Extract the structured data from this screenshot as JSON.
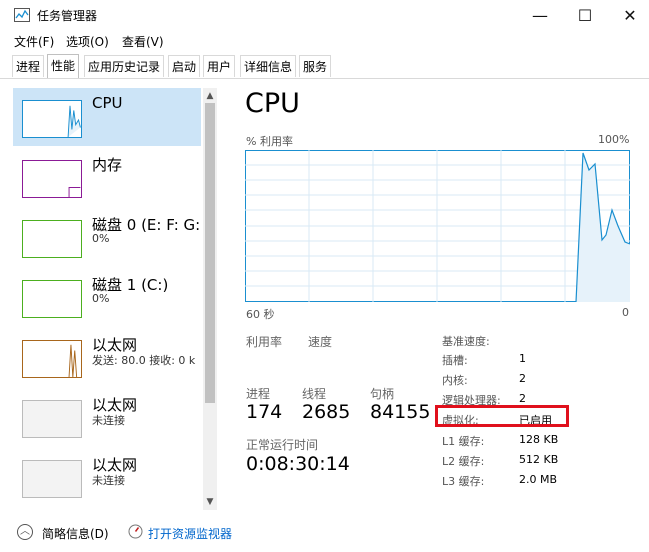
{
  "window": {
    "title": "任务管理器",
    "minimize": "—",
    "maximize": "☐",
    "close": "✕"
  },
  "menu": [
    "文件(F)",
    "选项(O)",
    "查看(V)"
  ],
  "tabs": [
    "进程",
    "性能",
    "应用历史记录",
    "启动",
    "用户",
    "详细信息",
    "服务"
  ],
  "active_tab": "性能",
  "sidebar": {
    "items": [
      {
        "title": "CPU",
        "sub": "",
        "color": "#1a8fd0"
      },
      {
        "title": "内存",
        "sub": "",
        "color": "#8b1a96"
      },
      {
        "title": "磁盘 0 (E: F: G:",
        "sub": "0%",
        "color": "#4caf1f"
      },
      {
        "title": "磁盘 1 (C:)",
        "sub": "0%",
        "color": "#4caf1f"
      },
      {
        "title": "以太网",
        "sub": "发送: 80.0  接收: 0 k",
        "color": "#a8661c"
      },
      {
        "title": "以太网",
        "sub": "未连接",
        "color": "#bbbbbb"
      },
      {
        "title": "以太网",
        "sub": "未连接",
        "color": "#bbbbbb"
      }
    ]
  },
  "cpu": {
    "title": "CPU",
    "graph_label": "% 利用率",
    "graph_max": "100%",
    "graph_time": "60 秒",
    "graph_zero": "0",
    "utilization_label": "利用率",
    "speed_label": "速度",
    "processes_label": "进程",
    "processes": "174",
    "threads_label": "线程",
    "threads": "2685",
    "handles_label": "句柄",
    "handles": "84155",
    "uptime_label": "正常运行时间",
    "uptime": "0:08:30:14",
    "specs": [
      {
        "label": "基准速度:",
        "value": ""
      },
      {
        "label": "插槽:",
        "value": "1"
      },
      {
        "label": "内核:",
        "value": "2"
      },
      {
        "label": "逻辑处理器:",
        "value": "2"
      },
      {
        "label": "虚拟化:",
        "value": "已启用"
      },
      {
        "label": "L1 缓存:",
        "value": "128 KB"
      },
      {
        "label": "L2 缓存:",
        "value": "512 KB"
      },
      {
        "label": "L3 缓存:",
        "value": "2.0 MB"
      }
    ]
  },
  "footer": {
    "collapse": "简略信息(D)",
    "monitor": "打开资源监视器"
  },
  "colors": {
    "cpu_line": "#1a8fd0",
    "cpu_fill": "#e6f2fa",
    "grid": "#d9eaf5",
    "highlight": "#e0101c"
  }
}
